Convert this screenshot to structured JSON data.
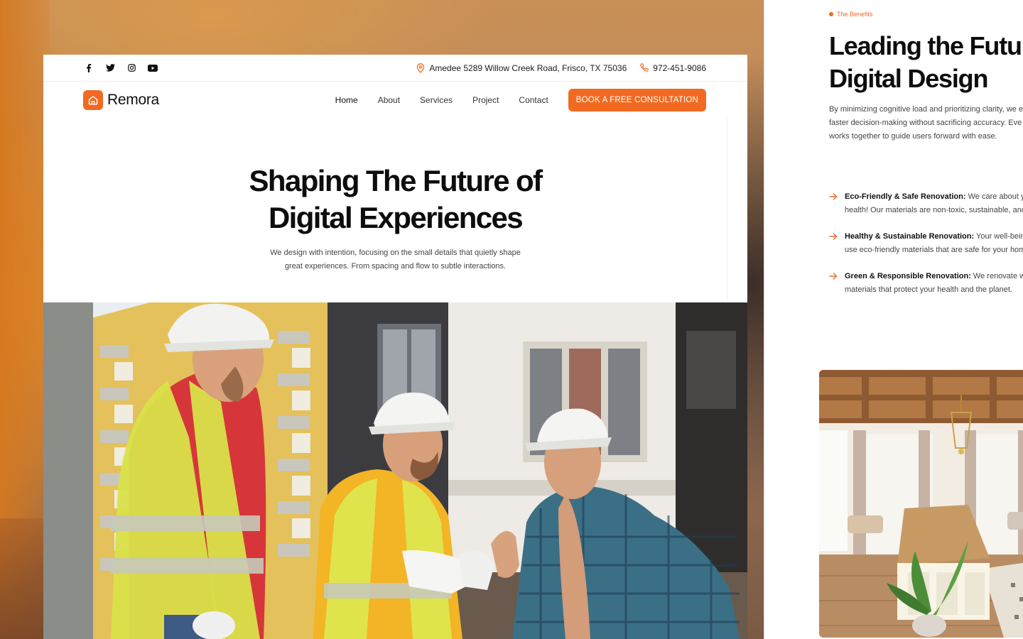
{
  "topbar": {
    "socials": [
      "facebook-icon",
      "twitter-icon",
      "instagram-icon",
      "youtube-icon"
    ],
    "address": "Amedee 5289 Willow Creek Road, Frisco, TX 75036",
    "phone": "972-451-9086"
  },
  "brand": {
    "name": "Remora",
    "accent": "#f26a21"
  },
  "nav": {
    "items": [
      {
        "label": "Home"
      },
      {
        "label": "About"
      },
      {
        "label": "Services"
      },
      {
        "label": "Project"
      },
      {
        "label": "Contact"
      }
    ],
    "cta": "BOOK A FREE CONSULTATION"
  },
  "hero": {
    "title_line1": "Shaping The Future of",
    "title_line2": "Digital Experiences",
    "subtitle_line1": "We design with intention, focusing on the small details that quietly shape",
    "subtitle_line2": "great experiences. From spacing and flow to subtle interactions."
  },
  "benefits_panel": {
    "eyebrow": "The Benefits",
    "title_line1": "Leading the Futu",
    "title_line2": "Digital Design",
    "desc_line1": "By minimizing cognitive load and prioritizing clarity, we e",
    "desc_line2": "faster decision-making without sacrificing accuracy. Eve",
    "desc_line3": "works together to guide users forward with ease.",
    "items": [
      {
        "title": "Eco-Friendly & Safe Renovation:",
        "line1": " We care about you",
        "line2": "health! Our materials are non-toxic, sustainable, and"
      },
      {
        "title": "Healthy & Sustainable Renovation:",
        "line1": " Your well-being",
        "line2": "use eco-friendly materials that are safe for your hom"
      },
      {
        "title": "Green & Responsible Renovation:",
        "line1": " We renovate with",
        "line2": "materials that protect your health and the planet."
      }
    ]
  }
}
